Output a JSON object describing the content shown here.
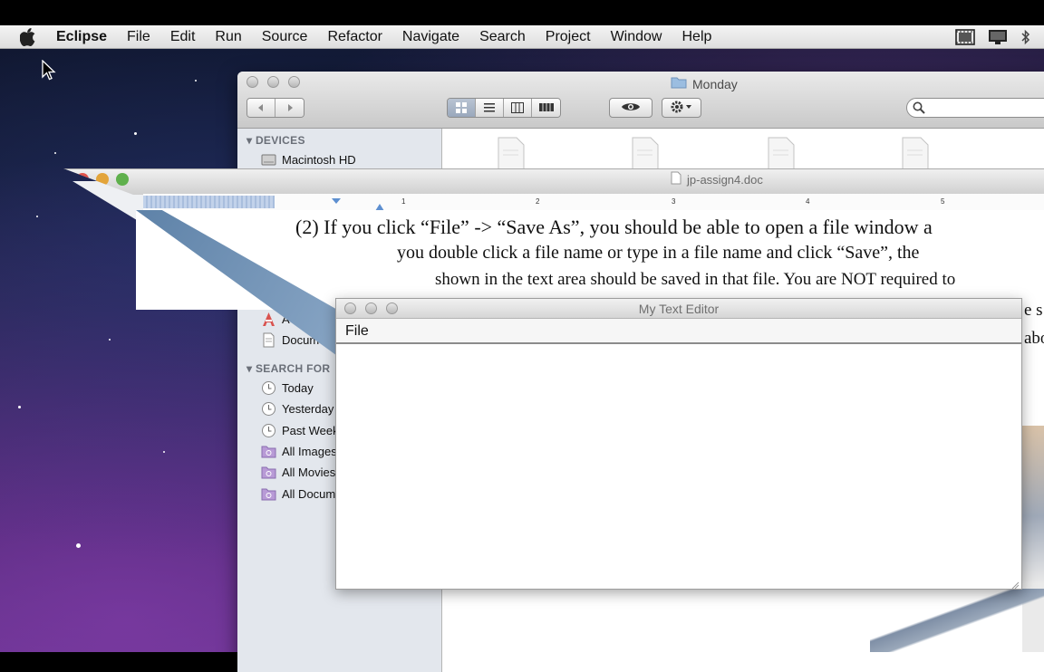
{
  "menubar": {
    "app_name": "Eclipse",
    "items": [
      "File",
      "Edit",
      "Run",
      "Source",
      "Refactor",
      "Navigate",
      "Search",
      "Project",
      "Window",
      "Help"
    ]
  },
  "finder": {
    "title": "Monday",
    "sidebar": {
      "devices_header": "DEVICES",
      "device_item": "Macintosh HD",
      "places_items": [
        "A",
        "Documen"
      ],
      "search_header": "SEARCH FOR",
      "search_items": [
        "Today",
        "Yesterday",
        "Past Week",
        "All Images",
        "All Movies",
        "All Documents"
      ]
    }
  },
  "document": {
    "filename": "jp-assign4.doc",
    "ruler_ticks": [
      "1",
      "2",
      "3",
      "4",
      "5"
    ],
    "lines": [
      "(2)     If you click “File” -> “Save As”, you should be able to open a file window a",
      "you double click a file name or type in a file name and click “Save”, the",
      "shown in the text area should be saved in that file. You are NOT required to",
      "e s",
      "abo"
    ]
  },
  "editor": {
    "title": "My Text Editor",
    "menu_file": "File"
  }
}
